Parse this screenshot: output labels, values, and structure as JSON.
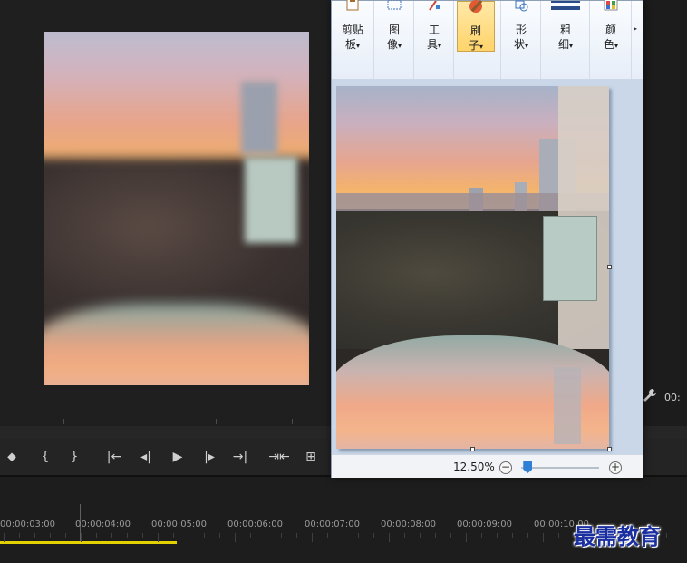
{
  "paint": {
    "ribbon_buttons": [
      {
        "line1": "剪贴",
        "line2": "板",
        "icon": "clipboard-icon"
      },
      {
        "line1": "图",
        "line2": "像",
        "icon": "image-select-icon"
      },
      {
        "line1": "工",
        "line2": "具",
        "icon": "tools-icon"
      },
      {
        "line1": "刷",
        "line2": "子",
        "icon": "brush-icon",
        "active": true
      },
      {
        "line1": "形",
        "line2": "状",
        "icon": "shapes-icon"
      },
      {
        "line1": "粗",
        "line2": "细",
        "icon": "line-width-icon"
      },
      {
        "line1": "颜",
        "line2": "色",
        "icon": "colors-icon"
      }
    ],
    "caret": "▾",
    "more": "▸",
    "zoom_level": "12.50%",
    "zoom_minus": "−",
    "zoom_plus": "+",
    "zoom_fraction": 0.03
  },
  "premiere": {
    "transport_glyphs": [
      "⬥",
      "{",
      "}",
      "|←",
      "◂|",
      "▶",
      "|▸",
      "→|",
      "⇥⇤",
      "⊞"
    ],
    "timecodes": [
      "00:00:03:00",
      "00:00:04:00",
      "00:00:05:00",
      "00:00:06:00",
      "00:00:07:00",
      "00:00:08:00",
      "00:00:09:00",
      "00:00:10:00"
    ],
    "right_time": "00:"
  },
  "watermark": "最需教育",
  "colors": {
    "work_area": "#e4d100",
    "active_ribbon": "#ffd46a",
    "zoom_thumb": "#2f7fd6"
  }
}
